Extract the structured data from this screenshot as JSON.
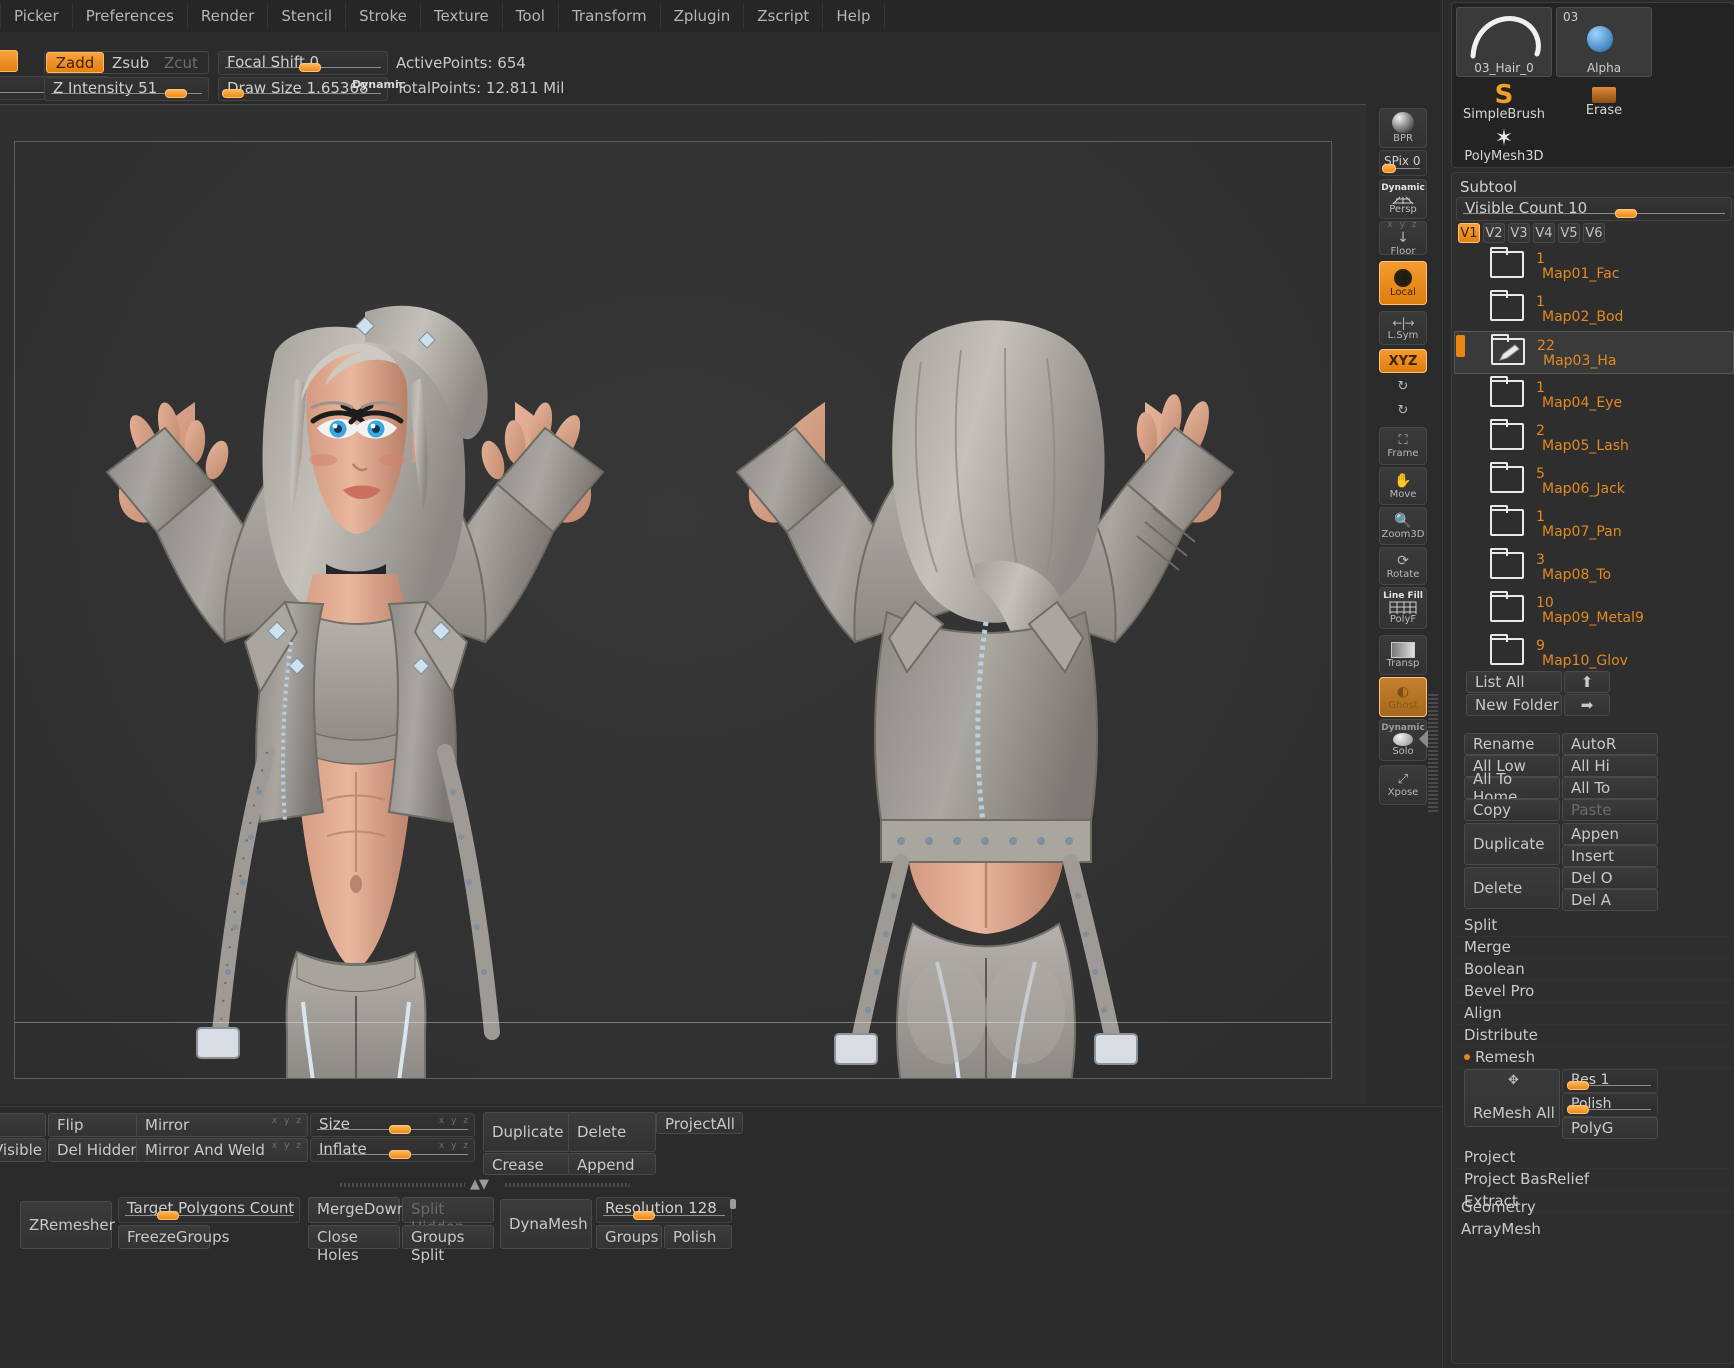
{
  "menubar": {
    "items": [
      "Picker",
      "Preferences",
      "Render",
      "Stencil",
      "Stroke",
      "Texture",
      "Tool",
      "Transform",
      "Zplugin",
      "Zscript",
      "Help"
    ]
  },
  "brushbar": {
    "zadd": "Zadd",
    "zsub": "Zsub",
    "zcut": "Zcut",
    "z_intensity": "Z Intensity 51",
    "focal_shift": "Focal Shift 0",
    "draw_size": "Draw Size 1.65368",
    "dynamic": "Dynamic",
    "active_points": "ActivePoints: 654",
    "total_points": "TotalPoints: 12.811 Mil"
  },
  "rightcol": {
    "bpr": "BPR",
    "spix": "SPix 0",
    "dynamic": "Dynamic",
    "persp": "Persp",
    "floor": "Floor",
    "local": "Local",
    "lsym": "L.Sym",
    "xyz": "XYZ",
    "rot_y": "Y",
    "rot_z": "Z",
    "frame": "Frame",
    "move": "Move",
    "zoom3d": "Zoom3D",
    "rotate": "Rotate",
    "linefill": "Line Fill",
    "polyf": "PolyF",
    "transp": "Transp",
    "ghost": "Ghost",
    "dynamic2": "Dynamic",
    "solo": "Solo",
    "xpose": "Xpose"
  },
  "brushpanel": {
    "alpha_name": "03_Hair_0",
    "alpha_label": "Alpha",
    "second_thumb": "03",
    "simplebrush": "SimpleBrush",
    "erase": "Erase",
    "polymesh3d": "PolyMesh3D"
  },
  "subtool": {
    "title": "Subtool",
    "visible_count": "Visible Count 10",
    "vtabs": [
      "V1",
      "V2",
      "V3",
      "V4",
      "V5",
      "V6"
    ],
    "active_vtab": "V1",
    "items": [
      {
        "count": "1",
        "name": "Map01_Fac",
        "selected": false
      },
      {
        "count": "1",
        "name": "Map02_Bod",
        "selected": false
      },
      {
        "count": "22",
        "name": "Map03_Ha",
        "selected": true
      },
      {
        "count": "1",
        "name": "Map04_Eye",
        "selected": false
      },
      {
        "count": "2",
        "name": "Map05_Lash",
        "selected": false
      },
      {
        "count": "5",
        "name": "Map06_Jack",
        "selected": false
      },
      {
        "count": "1",
        "name": "Map07_Pan",
        "selected": false
      },
      {
        "count": "3",
        "name": "Map08_To",
        "selected": false
      },
      {
        "count": "10",
        "name": "Map09_Metal9",
        "selected": false
      },
      {
        "count": "9",
        "name": "Map10_Glov",
        "selected": false
      }
    ],
    "list_all": "List All",
    "new_folder": "New Folder",
    "rename": "Rename",
    "all_low": "All Low",
    "all_to_home": "All To Home",
    "copy": "Copy",
    "duplicate": "Duplicate",
    "delete": "Delete",
    "autor": "AutoR",
    "all_hi": "All Hi",
    "all_to": "All To",
    "paste": "Paste",
    "append": "Appen",
    "insert": "Insert",
    "del_other": "Del O",
    "del_all": "Del A",
    "split": "Split",
    "merge": "Merge",
    "boolean": "Boolean",
    "bevel_pro": "Bevel Pro",
    "align": "Align",
    "distribute": "Distribute",
    "remesh": "Remesh",
    "remesh_all": "ReMesh All",
    "res": "Res 1",
    "polish": "Polish",
    "polyg": "PolyG",
    "project": "Project",
    "project_basrelief": "Project BasRelief",
    "extract": "Extract",
    "geometry": "Geometry",
    "arraymesh": "ArrayMesh"
  },
  "bottombar": {
    "visible": "Visible",
    "flip": "Flip",
    "del_hidden": "Del Hidden",
    "mirror": "Mirror",
    "mirror_and_weld": "Mirror And Weld",
    "size": "Size",
    "inflate": "Inflate",
    "duplicate": "Duplicate",
    "crease": "Crease",
    "delete": "Delete",
    "append": "Append",
    "project_all": "ProjectAll",
    "zremesher": "ZRemesher",
    "target_polygons_count": "Target Polygons Count 5",
    "freeze_groups": "FreezeGroups",
    "merge_down": "MergeDown",
    "split_hidden": "Split Hidden",
    "close_holes": "Close Holes",
    "groups_split": "Groups Split",
    "dynamesh": "DynaMesh",
    "resolution": "Resolution 128",
    "groups": "Groups",
    "polish": "Polish"
  },
  "colors": {
    "accent": "#e8860f",
    "panel": "#2b2b2b",
    "canvas": "#333333",
    "text": "#c8c8c8",
    "subtool_text": "#e08a22"
  }
}
